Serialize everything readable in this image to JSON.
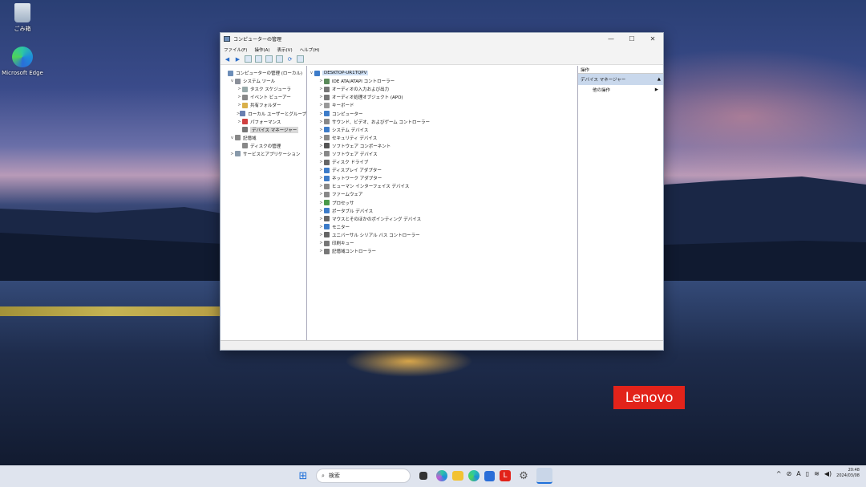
{
  "desktop": {
    "icons": [
      {
        "label": "ごみ箱",
        "icon": "recycle-bin-icon"
      },
      {
        "label": "Microsoft Edge",
        "icon": "edge-icon"
      }
    ],
    "brand": "Lenovo"
  },
  "window": {
    "title": "コンピューターの管理",
    "controls": {
      "minimize": "—",
      "maximize": "☐",
      "close": "✕"
    },
    "menu": [
      "ファイル(F)",
      "操作(A)",
      "表示(V)",
      "ヘルプ(H)"
    ],
    "left_tree": [
      {
        "label": "コンピューターの管理 (ローカル)",
        "arrow": "",
        "indent": 0,
        "color": "#6c8db8"
      },
      {
        "label": "システム ツール",
        "arrow": "v",
        "indent": 1,
        "color": "#8a8f99"
      },
      {
        "label": "タスク スケジューラ",
        "arrow": ">",
        "indent": 2,
        "color": "#9aa"
      },
      {
        "label": "イベント ビューアー",
        "arrow": ">",
        "indent": 2,
        "color": "#888"
      },
      {
        "label": "共有フォルダー",
        "arrow": ">",
        "indent": 2,
        "color": "#d9b04a"
      },
      {
        "label": "ローカル ユーザーとグループ",
        "arrow": ">",
        "indent": 2,
        "color": "#6a7fb0"
      },
      {
        "label": "パフォーマンス",
        "arrow": ">",
        "indent": 2,
        "color": "#d04040"
      },
      {
        "label": "デバイス マネージャー",
        "arrow": "",
        "indent": 2,
        "color": "#777",
        "selected": true
      },
      {
        "label": "記憶域",
        "arrow": "v",
        "indent": 1,
        "color": "#888"
      },
      {
        "label": "ディスクの管理",
        "arrow": "",
        "indent": 2,
        "color": "#888"
      },
      {
        "label": "サービスとアプリケーション",
        "arrow": ">",
        "indent": 1,
        "color": "#8899aa"
      }
    ],
    "device_root": "DESKTOP-UR1TQPV",
    "devices": [
      {
        "label": "IDE ATA/ATAPI コントローラー",
        "color": "#5a8a5a"
      },
      {
        "label": "オーディオの入力および出力",
        "color": "#777"
      },
      {
        "label": "オーディオ処理オブジェクト (APO)",
        "color": "#777"
      },
      {
        "label": "キーボード",
        "color": "#999"
      },
      {
        "label": "コンピューター",
        "color": "#3d7cc9"
      },
      {
        "label": "サウンド、ビデオ、およびゲーム コントローラー",
        "color": "#888"
      },
      {
        "label": "システム デバイス",
        "color": "#3d7cc9"
      },
      {
        "label": "セキュリティ デバイス",
        "color": "#888"
      },
      {
        "label": "ソフトウェア コンポーネント",
        "color": "#555"
      },
      {
        "label": "ソフトウェア デバイス",
        "color": "#888"
      },
      {
        "label": "ディスク ドライブ",
        "color": "#666"
      },
      {
        "label": "ディスプレイ アダプター",
        "color": "#3d7cc9"
      },
      {
        "label": "ネットワーク アダプター",
        "color": "#3d7cc9"
      },
      {
        "label": "ヒューマン インターフェイス デバイス",
        "color": "#888"
      },
      {
        "label": "ファームウェア",
        "color": "#888"
      },
      {
        "label": "プロセッサ",
        "color": "#4a9a4a"
      },
      {
        "label": "ポータブル デバイス",
        "color": "#3d7cc9"
      },
      {
        "label": "マウスとそのほかのポインティング デバイス",
        "color": "#666"
      },
      {
        "label": "モニター",
        "color": "#3d7cc9"
      },
      {
        "label": "ユニバーサル シリアル バス コントローラー",
        "color": "#666"
      },
      {
        "label": "印刷キュー",
        "color": "#777"
      },
      {
        "label": "記憶域コントローラー",
        "color": "#777"
      }
    ],
    "operations": {
      "header": "操作",
      "section": "デバイス マネージャー",
      "section_arrow": "▲",
      "item": "他の操作",
      "item_arrow": "▶"
    }
  },
  "taskbar": {
    "search_placeholder": "検索",
    "clock_time": "20:48",
    "clock_date": "2024/03/08",
    "accent": "#dfe4ee"
  }
}
